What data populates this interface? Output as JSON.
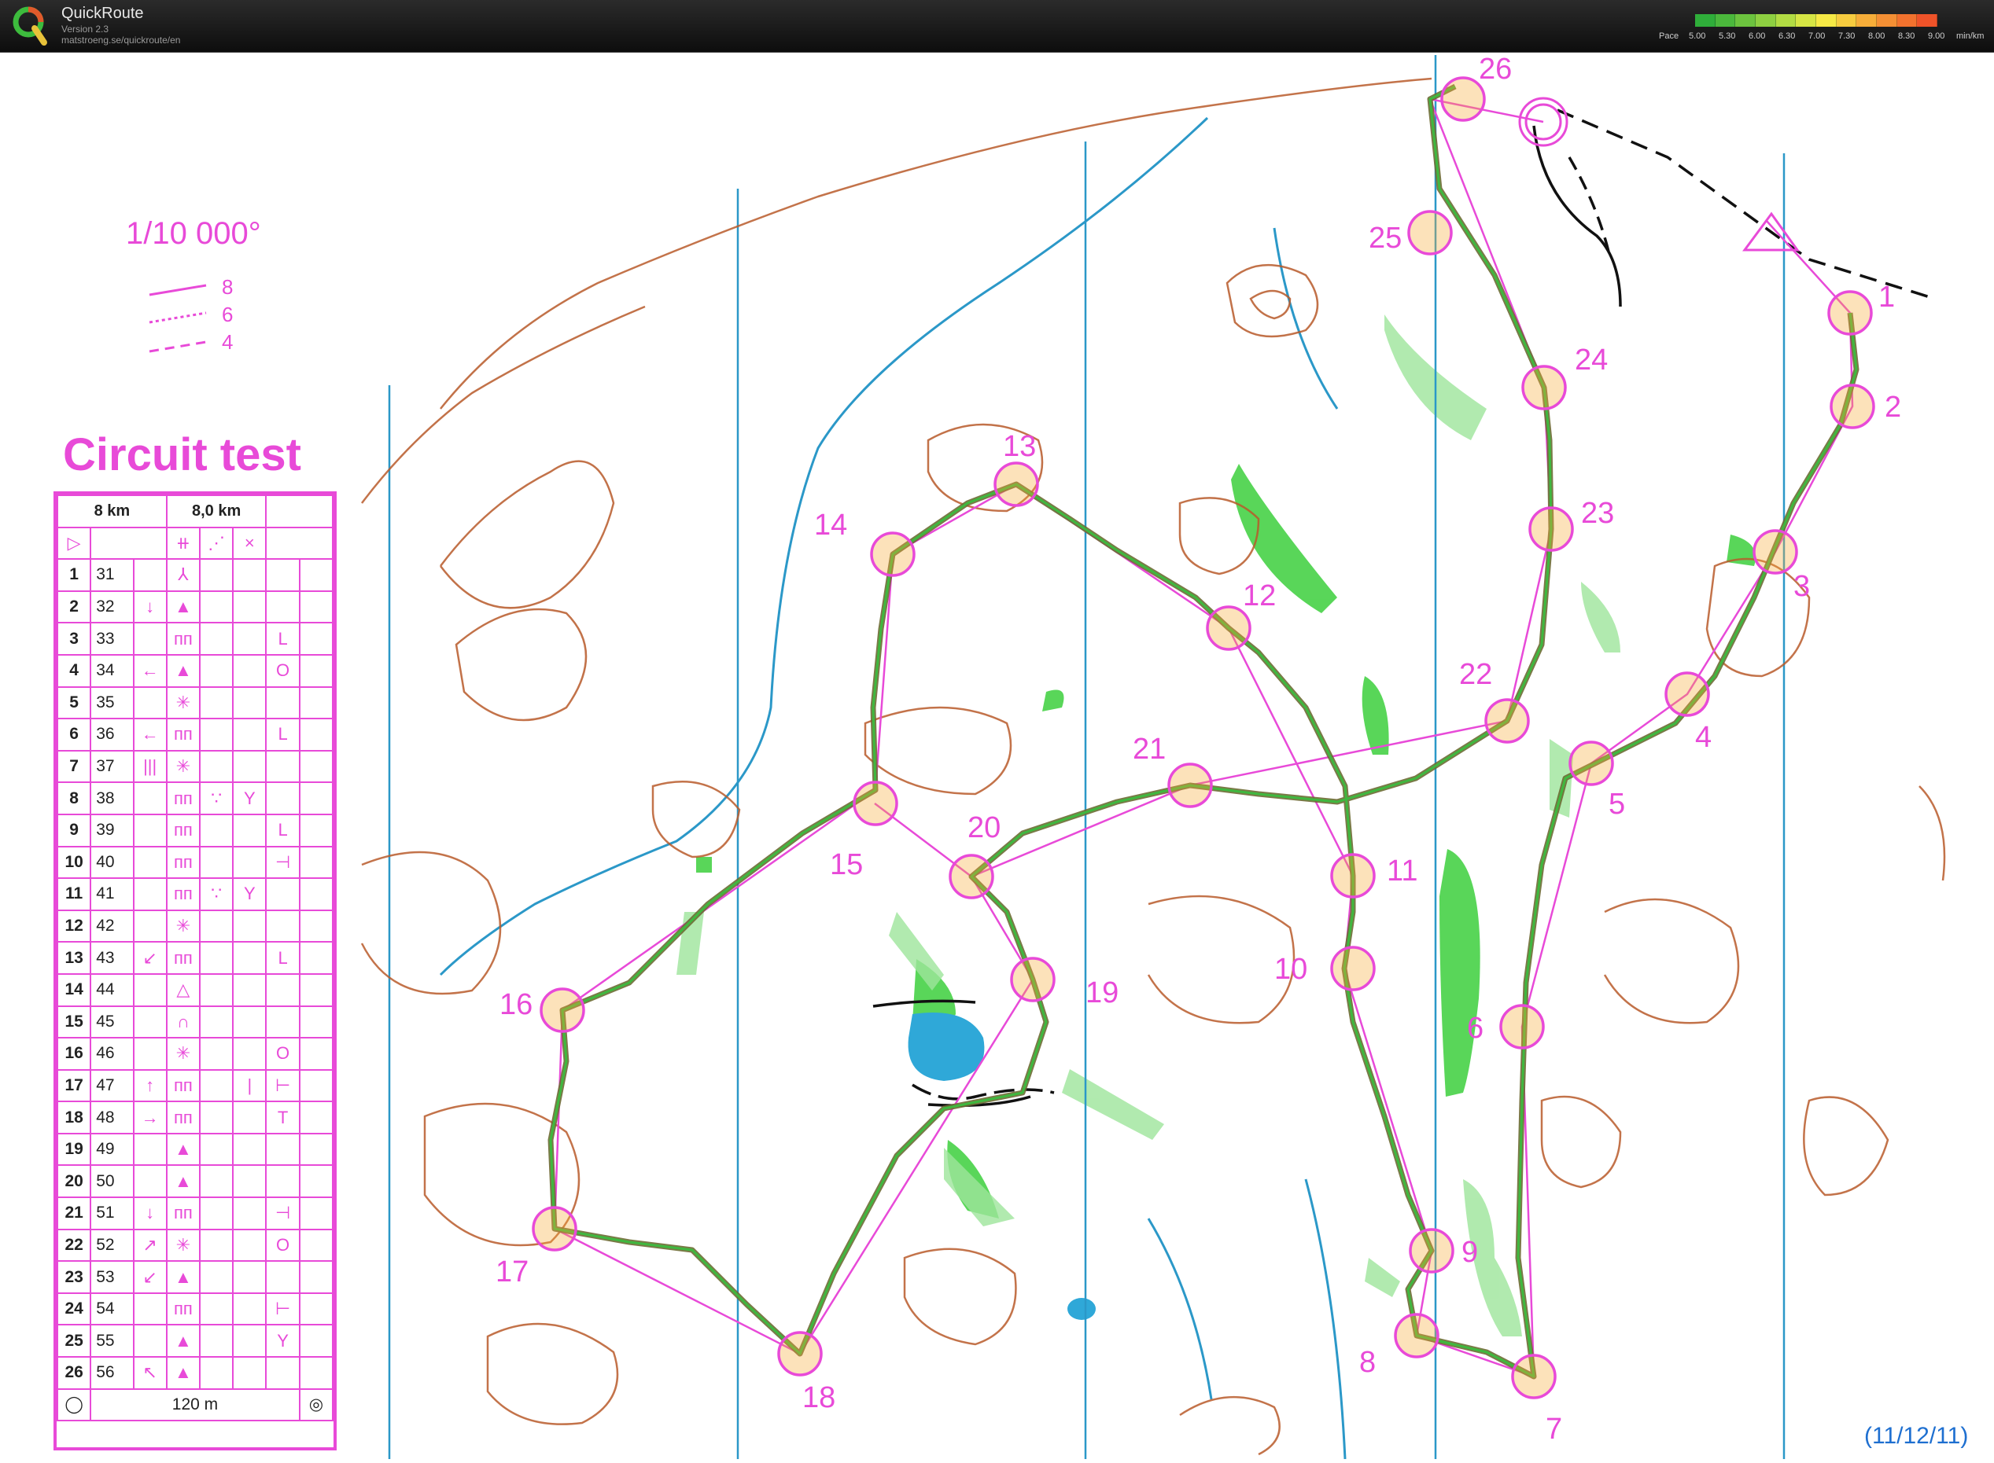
{
  "app": {
    "name": "QuickRoute",
    "version": "Version 2.3",
    "url": "matstroeng.se/quickroute/en"
  },
  "pace_legend": {
    "label": "Pace",
    "ticks": [
      "5.00",
      "5.30",
      "6.00",
      "6.30",
      "7.00",
      "7.30",
      "8.00",
      "8.30",
      "9.00"
    ],
    "unit": "min/km",
    "colors": [
      "#2fae3a",
      "#4bb83c",
      "#6cc33e",
      "#8ed041",
      "#b2dc43",
      "#d6e544",
      "#f6e945",
      "#f7cc3f",
      "#f6ad39",
      "#f48f34",
      "#f2722e",
      "#ef5329"
    ]
  },
  "map": {
    "scale": "1/10 000°",
    "legend_lines": [
      {
        "value": "8",
        "style": "solid"
      },
      {
        "value": "6",
        "style": "dotted"
      },
      {
        "value": "4",
        "style": "dashed"
      }
    ],
    "title": "Circuit test",
    "date": "(11/12/11)",
    "colors": {
      "course": "#e84ad8",
      "route_green": "#2fae3a",
      "route_dark": "#6b6b33",
      "contour": "#b85a2a",
      "water": "#2b98c8",
      "vegetation": "#3ccf3c"
    }
  },
  "description_sheet": {
    "header": [
      "8 km",
      "8,0 km"
    ],
    "footer": "120 m",
    "rows": [
      {
        "num": "1",
        "code": "31",
        "d": "",
        "c": "⅄",
        "e": "",
        "f": "",
        "g": ""
      },
      {
        "num": "2",
        "code": "32",
        "d": "↓",
        "c": "▲",
        "e": "",
        "f": "",
        "g": ""
      },
      {
        "num": "3",
        "code": "33",
        "d": "",
        "c": "ᴨᴨ",
        "e": "",
        "f": "",
        "g": "L"
      },
      {
        "num": "4",
        "code": "34",
        "d": "←",
        "c": "▲",
        "e": "",
        "f": "",
        "g": "O"
      },
      {
        "num": "5",
        "code": "35",
        "d": "",
        "c": "✳",
        "e": "",
        "f": "",
        "g": ""
      },
      {
        "num": "6",
        "code": "36",
        "d": "←",
        "c": "ᴨᴨ",
        "e": "",
        "f": "",
        "g": "L"
      },
      {
        "num": "7",
        "code": "37",
        "d": "|||",
        "c": "✳",
        "e": "",
        "f": "",
        "g": ""
      },
      {
        "num": "8",
        "code": "38",
        "d": "",
        "c": "ᴨᴨ",
        "e": "∵",
        "f": "Y",
        "g": ""
      },
      {
        "num": "9",
        "code": "39",
        "d": "",
        "c": "ᴨᴨ",
        "e": "",
        "f": "",
        "g": "L"
      },
      {
        "num": "10",
        "code": "40",
        "d": "",
        "c": "ᴨᴨ",
        "e": "",
        "f": "",
        "g": "⊣"
      },
      {
        "num": "11",
        "code": "41",
        "d": "",
        "c": "ᴨᴨ",
        "e": "∵",
        "f": "Y",
        "g": ""
      },
      {
        "num": "12",
        "code": "42",
        "d": "",
        "c": "✳",
        "e": "",
        "f": "",
        "g": ""
      },
      {
        "num": "13",
        "code": "43",
        "d": "↙",
        "c": "ᴨᴨ",
        "e": "",
        "f": "",
        "g": "L"
      },
      {
        "num": "14",
        "code": "44",
        "d": "",
        "c": "△",
        "e": "",
        "f": "",
        "g": ""
      },
      {
        "num": "15",
        "code": "45",
        "d": "",
        "c": "∩",
        "e": "",
        "f": "",
        "g": ""
      },
      {
        "num": "16",
        "code": "46",
        "d": "",
        "c": "✳",
        "e": "",
        "f": "",
        "g": "O"
      },
      {
        "num": "17",
        "code": "47",
        "d": "↑",
        "c": "ᴨᴨ",
        "e": "",
        "f": "|",
        "g": "⊢"
      },
      {
        "num": "18",
        "code": "48",
        "d": "→",
        "c": "ᴨᴨ",
        "e": "",
        "f": "",
        "g": "T"
      },
      {
        "num": "19",
        "code": "49",
        "d": "",
        "c": "▲",
        "e": "",
        "f": "",
        "g": ""
      },
      {
        "num": "20",
        "code": "50",
        "d": "",
        "c": "▲",
        "e": "",
        "f": "",
        "g": ""
      },
      {
        "num": "21",
        "code": "51",
        "d": "↓",
        "c": "ᴨᴨ",
        "e": "",
        "f": "",
        "g": "⊣"
      },
      {
        "num": "22",
        "code": "52",
        "d": "↗",
        "c": "✳",
        "e": "",
        "f": "",
        "g": "O"
      },
      {
        "num": "23",
        "code": "53",
        "d": "↙",
        "c": "▲",
        "e": "",
        "f": "",
        "g": ""
      },
      {
        "num": "24",
        "code": "54",
        "d": "",
        "c": "ᴨᴨ",
        "e": "",
        "f": "",
        "g": "⊢"
      },
      {
        "num": "25",
        "code": "55",
        "d": "",
        "c": "▲",
        "e": "",
        "f": "",
        "g": "Y"
      },
      {
        "num": "26",
        "code": "56",
        "d": "↖",
        "c": "▲",
        "e": "",
        "f": "",
        "g": ""
      }
    ]
  },
  "controls": [
    {
      "num": "1"
    },
    {
      "num": "2"
    },
    {
      "num": "3"
    },
    {
      "num": "4"
    },
    {
      "num": "5"
    },
    {
      "num": "6"
    },
    {
      "num": "7"
    },
    {
      "num": "8"
    },
    {
      "num": "9"
    },
    {
      "num": "10"
    },
    {
      "num": "11"
    },
    {
      "num": "12"
    },
    {
      "num": "13"
    },
    {
      "num": "14"
    },
    {
      "num": "15"
    },
    {
      "num": "16"
    },
    {
      "num": "17"
    },
    {
      "num": "18"
    },
    {
      "num": "19"
    },
    {
      "num": "20"
    },
    {
      "num": "21"
    },
    {
      "num": "22"
    },
    {
      "num": "23"
    },
    {
      "num": "24"
    },
    {
      "num": "25"
    },
    {
      "num": "26"
    }
  ]
}
